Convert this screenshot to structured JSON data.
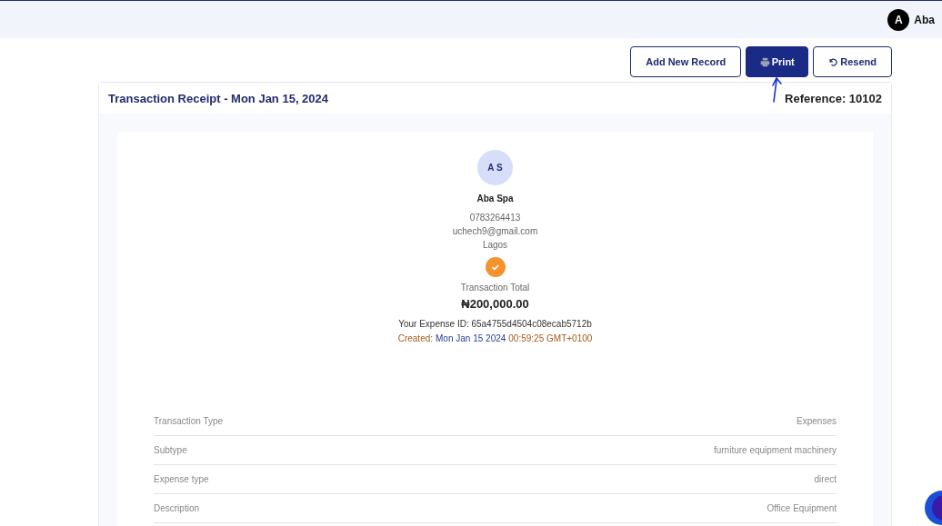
{
  "user": {
    "initial": "A",
    "name": "Aba"
  },
  "actions": [
    {
      "label": "Add New Record",
      "kind": "outline"
    },
    {
      "label": "Print",
      "kind": "primary"
    },
    {
      "label": "Resend",
      "kind": "resend"
    }
  ],
  "receipt": {
    "title": "Transaction Receipt - Mon Jan 15, 2024",
    "reference": "Reference: 10102",
    "initials": "A S",
    "name": "Aba Spa",
    "phone": "0783264413",
    "email": "uchech9@gmail.com",
    "city": "Lagos",
    "total_label": "Transaction Total",
    "total": "₦200,000.00",
    "expense_id": "Your Expense ID: 65a4755d4504c08ecab5712b",
    "created_label": "Created:",
    "created_date": "Mon Jan 15 2024",
    "created_time": "00:59:25 GMT+0100",
    "rows": [
      {
        "label": "Transaction Type",
        "value": "Expenses"
      },
      {
        "label": "Subtype",
        "value": "furniture equipment machinery"
      },
      {
        "label": "Expense type",
        "value": "direct"
      },
      {
        "label": "Description",
        "value": "Office Equipment"
      }
    ]
  }
}
